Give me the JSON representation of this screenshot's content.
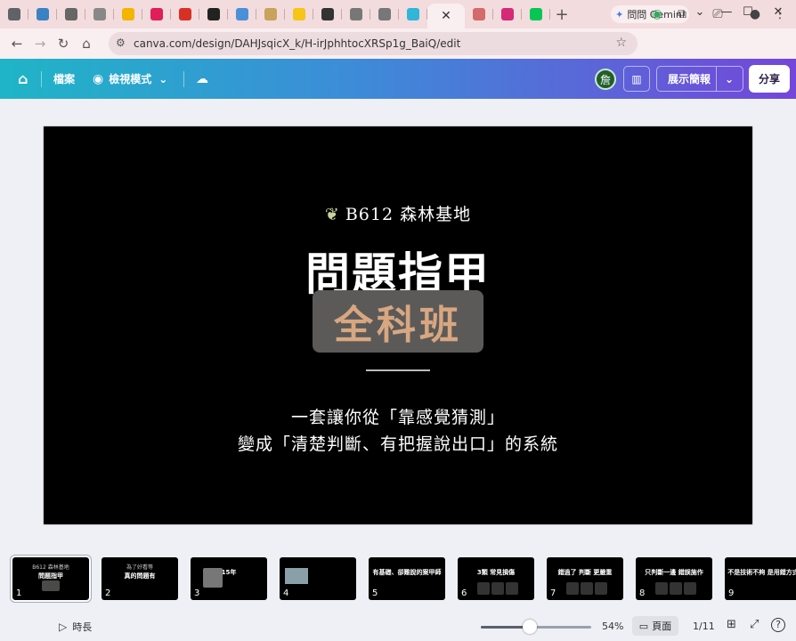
{
  "browser": {
    "tabs": [
      {
        "icon": "chrome-icon",
        "color": "#5f6368"
      },
      {
        "icon": "grid-app-icon",
        "color": "#3b82c4"
      },
      {
        "icon": "image-icon",
        "color": "#666666"
      },
      {
        "icon": "mountain-icon",
        "color": "#888888"
      },
      {
        "icon": "drive-icon",
        "color": "#f4b400"
      },
      {
        "icon": "slack-icon",
        "color": "#e01e5a"
      },
      {
        "icon": "gmail-icon",
        "color": "#d93025"
      },
      {
        "icon": "github-icon",
        "color": "#222222"
      },
      {
        "icon": "photo-icon",
        "color": "#4a90d9"
      },
      {
        "icon": "bee-icon",
        "color": "#c9a25c"
      },
      {
        "icon": "bulb-icon",
        "color": "#f5c518"
      },
      {
        "icon": "sk-icon",
        "color": "#333333"
      },
      {
        "icon": "globe-icon",
        "color": "#777777"
      },
      {
        "icon": "globe-icon",
        "color": "#777777"
      },
      {
        "icon": "canva-icon",
        "color": "#2fb6d8"
      }
    ],
    "active_tab_close": "✕",
    "tabs_after": [
      {
        "icon": "sparkle-icon",
        "color": "#d56a6a"
      },
      {
        "icon": "instagram-icon",
        "color": "#d62976"
      },
      {
        "icon": "line-icon",
        "color": "#06c755"
      }
    ],
    "new_tab": "+",
    "gemini_label": "問問 Gemini",
    "url": "canva.com/design/DAHJsqicX_k/H-irJphhtocXRSp1g_BaiQ/edit"
  },
  "canva": {
    "file_label": "檔案",
    "view_mode_label": "檢視模式",
    "avatar_initial": "詹",
    "present_label": "展示簡報",
    "share_label": "分享"
  },
  "slide": {
    "subtitle": "B612 森林基地",
    "title": "問題指甲",
    "highlight": "全科班",
    "desc_line1": "一套讓你從「靠感覺猜測」",
    "desc_line2": "變成「清楚判斷、有把握說出口」的系統"
  },
  "thumbnails": [
    {
      "num": "1",
      "l1": "B612 森林基地",
      "l2": "問題指甲"
    },
    {
      "num": "2",
      "l1": "為了好看等",
      "l2": "真的問題有"
    },
    {
      "num": "3",
      "l1": "",
      "l2": "15年"
    },
    {
      "num": "4",
      "l1": "",
      "l2": ""
    },
    {
      "num": "5",
      "l1": "",
      "l2": "有基礎、卻難說的案甲師"
    },
    {
      "num": "6",
      "l1": "",
      "l2": "3類 常見損傷"
    },
    {
      "num": "7",
      "l1": "",
      "l2": "錯過了 判斷 更嚴重"
    },
    {
      "num": "8",
      "l1": "",
      "l2": "只判斷一邊 錯誤施作"
    },
    {
      "num": "9",
      "l1": "",
      "l2": "不是技術不夠 是用錯方式"
    }
  ],
  "bottom": {
    "duration_label": "時長",
    "zoom_value": 0.44,
    "zoom_label": "54%",
    "page_label": "頁面",
    "page_counter": "1/11",
    "help": "?"
  }
}
